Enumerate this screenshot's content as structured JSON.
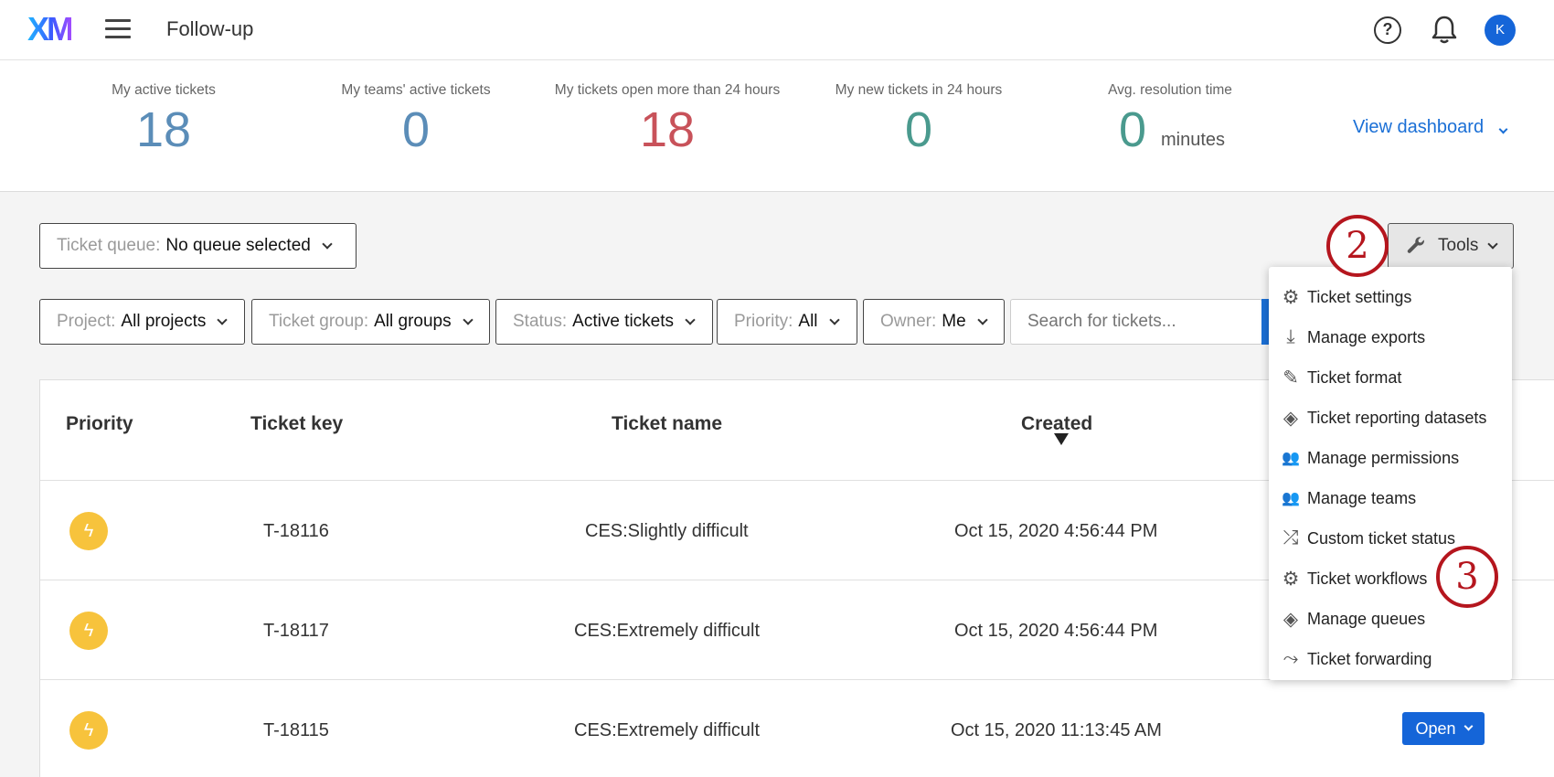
{
  "header": {
    "logo": "XM",
    "title": "Follow-up",
    "help_icon": "question-circle-icon",
    "help_glyph": "?",
    "notifications_icon": "bell-icon",
    "avatar_initial": "K"
  },
  "stats": [
    {
      "label": "My active tickets",
      "value": "18",
      "color": "#5b8db8"
    },
    {
      "label": "My teams' active tickets",
      "value": "0",
      "color": "#5b8db8"
    },
    {
      "label": "My tickets open more than 24 hours",
      "value": "18",
      "color": "#c8525a"
    },
    {
      "label": "My new tickets in 24 hours",
      "value": "0",
      "color": "#4a9a8e"
    },
    {
      "label": "Avg. resolution time",
      "value": "0",
      "color": "#4a9a8e"
    }
  ],
  "avg_unit": "minutes",
  "view_dashboard": "View dashboard",
  "queue": {
    "label": "Ticket queue:",
    "value": "No queue selected"
  },
  "filters": {
    "project": {
      "label": "Project:",
      "value": "All projects"
    },
    "ticket_group": {
      "label": "Ticket group:",
      "value": "All groups"
    },
    "status": {
      "label": "Status:",
      "value": "Active tickets"
    },
    "priority": {
      "label": "Priority:",
      "value": "All"
    },
    "owner": {
      "label": "Owner:",
      "value": "Me"
    }
  },
  "search": {
    "placeholder": "Search for tickets..."
  },
  "tools_label": "Tools",
  "table": {
    "headers": {
      "priority": "Priority",
      "key": "Ticket key",
      "name": "Ticket name",
      "created": "Created"
    },
    "rows": [
      {
        "priority_icon": "lightning-icon",
        "key": "T-18116",
        "name": "CES:Slightly difficult",
        "created": "Oct 15, 2020 4:56:44 PM"
      },
      {
        "priority_icon": "lightning-icon",
        "key": "T-18117",
        "name": "CES:Extremely difficult",
        "created": "Oct 15, 2020 4:56:44 PM"
      },
      {
        "priority_icon": "lightning-icon",
        "key": "T-18115",
        "name": "CES:Extremely difficult",
        "created": "Oct 15, 2020 11:13:45 AM",
        "status": "Open"
      }
    ]
  },
  "tools_menu": [
    {
      "label": "Ticket settings",
      "icon": "gear-icon",
      "glyph": "⚙"
    },
    {
      "label": "Manage exports",
      "icon": "download-icon",
      "glyph": "⤓"
    },
    {
      "label": "Ticket format",
      "icon": "pencil-icon",
      "glyph": "✎"
    },
    {
      "label": "Ticket reporting datasets",
      "icon": "ticket-tag-icon",
      "glyph": "◈"
    },
    {
      "label": "Manage permissions",
      "icon": "users-icon",
      "glyph": "👥"
    },
    {
      "label": "Manage teams",
      "icon": "users-icon",
      "glyph": "👥"
    },
    {
      "label": "Custom ticket status",
      "icon": "shuffle-icon",
      "glyph": "⤮"
    },
    {
      "label": "Ticket workflows",
      "icon": "gears-icon",
      "glyph": "⚙"
    },
    {
      "label": "Manage queues",
      "icon": "tags-icon",
      "glyph": "◈"
    },
    {
      "label": "Ticket forwarding",
      "icon": "user-forward-icon",
      "glyph": "⤳"
    }
  ],
  "callouts": [
    "2",
    "3"
  ]
}
